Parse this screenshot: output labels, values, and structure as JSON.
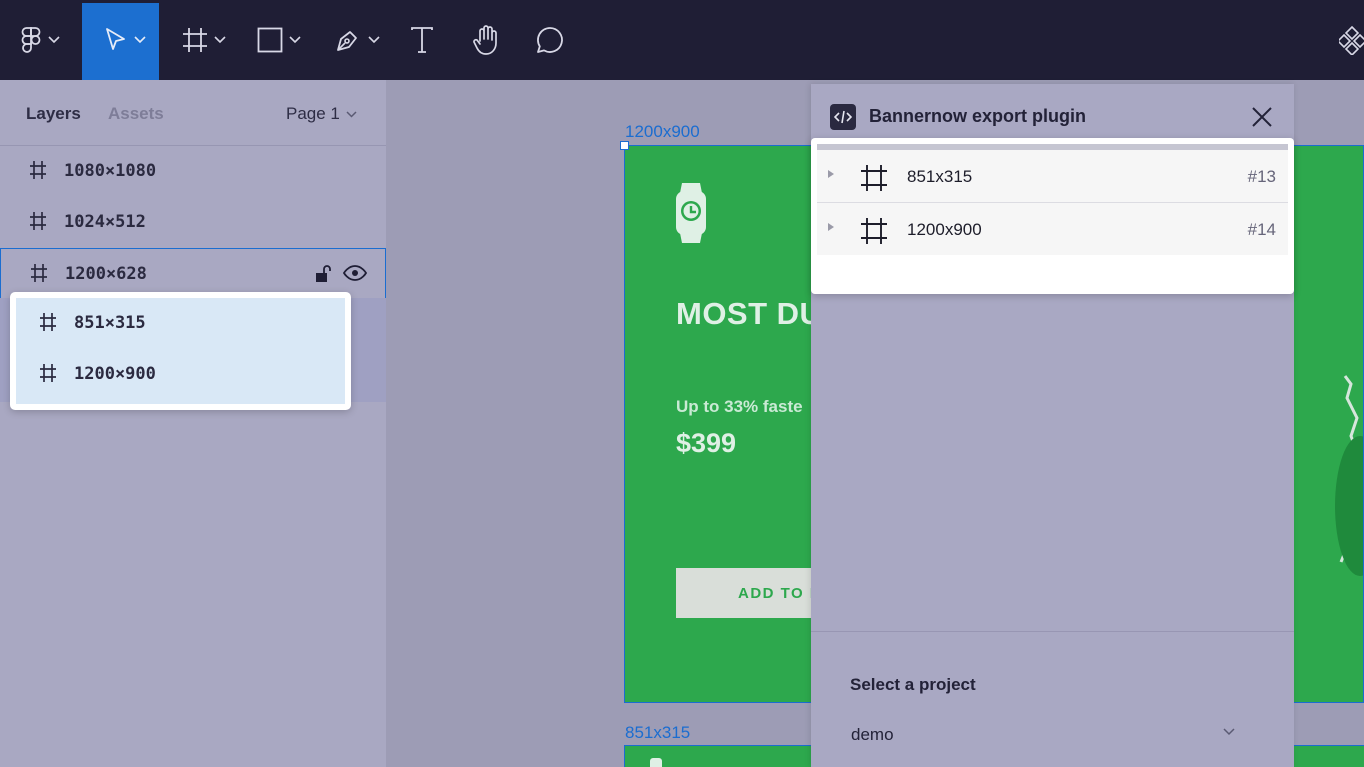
{
  "toolbar": {
    "tools": [
      {
        "icon": "figma-logo-icon"
      },
      {
        "icon": "move-pointer-icon",
        "active": true
      },
      {
        "icon": "frame-tool-icon"
      },
      {
        "icon": "rectangle-tool-icon"
      },
      {
        "icon": "pen-tool-icon"
      },
      {
        "icon": "text-tool-icon"
      },
      {
        "icon": "hand-tool-icon"
      },
      {
        "icon": "comment-tool-icon"
      },
      {
        "icon": "components-icon"
      }
    ],
    "active_color": "#1c6fd0"
  },
  "left_panel": {
    "tab_layers": "Layers",
    "tab_assets": "Assets",
    "page_label": "Page 1",
    "layers": [
      {
        "name": "1080×1080"
      },
      {
        "name": "1024×512"
      },
      {
        "name": "1200×628",
        "selected": true
      }
    ],
    "drag_items": [
      {
        "name": "851×315"
      },
      {
        "name": "1200×900"
      }
    ]
  },
  "canvas": {
    "frame_label_top": "1200x900",
    "frame_label_bottom": "851x315",
    "headline": "MOST DU",
    "subline": "Up to 33% faste",
    "price": "$399",
    "cta": "ADD TO B",
    "frame_color": "#2da84d"
  },
  "plugin": {
    "title": "Bannernow export plugin",
    "rows": [
      {
        "name": "851x315",
        "id": "#13"
      },
      {
        "name": "1200x900",
        "id": "#14"
      }
    ],
    "select_label": "Select a project",
    "select_value": "demo"
  }
}
